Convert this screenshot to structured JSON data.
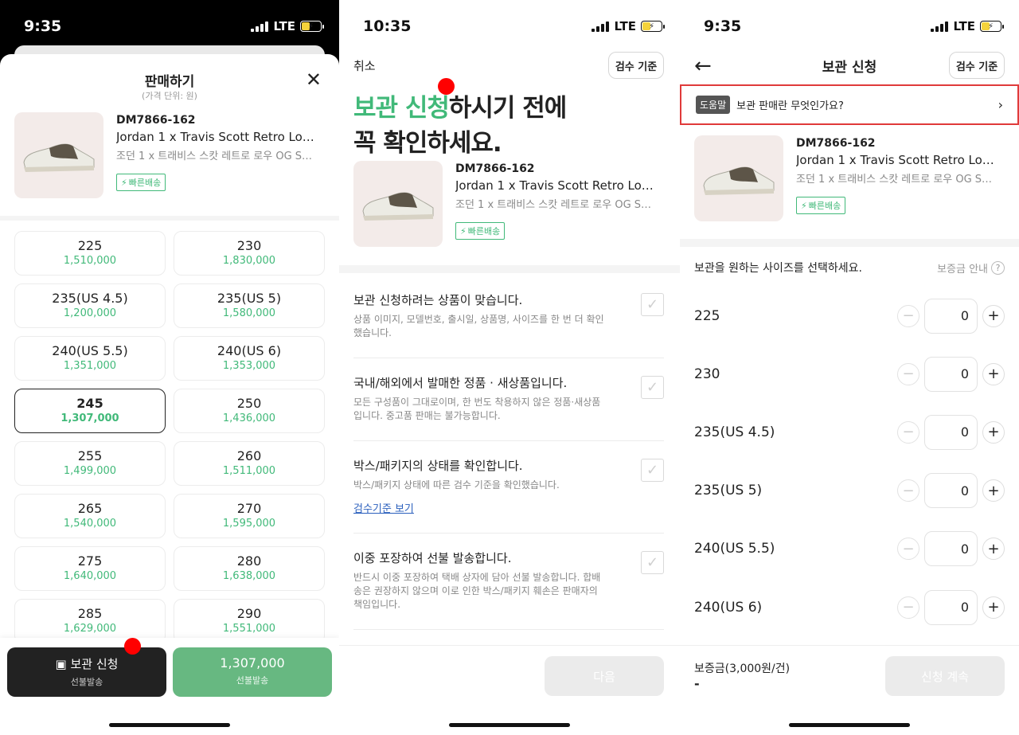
{
  "status_bars": [
    {
      "time": "9:35",
      "network": "LTE"
    },
    {
      "time": "10:35",
      "network": "LTE"
    },
    {
      "time": "9:35",
      "network": "LTE"
    }
  ],
  "product": {
    "code": "DM7866-162",
    "name": "Jordan 1 x Travis Scott Retro Low…",
    "korean_name": "조던 1 x 트래비스 스캇 레트로 로우 OG S…",
    "badge": "빠른배송"
  },
  "sell_sheet": {
    "title": "판매하기",
    "subtitle": "(가격 단위: 원)",
    "selected_index": 6,
    "sizes": [
      {
        "size": "225",
        "price": "1,510,000"
      },
      {
        "size": "230",
        "price": "1,830,000"
      },
      {
        "size": "235(US 4.5)",
        "price": "1,200,000"
      },
      {
        "size": "235(US 5)",
        "price": "1,580,000"
      },
      {
        "size": "240(US 5.5)",
        "price": "1,351,000"
      },
      {
        "size": "240(US 6)",
        "price": "1,353,000"
      },
      {
        "size": "245",
        "price": "1,307,000"
      },
      {
        "size": "250",
        "price": "1,436,000"
      },
      {
        "size": "255",
        "price": "1,499,000"
      },
      {
        "size": "260",
        "price": "1,511,000"
      },
      {
        "size": "265",
        "price": "1,540,000"
      },
      {
        "size": "270",
        "price": "1,595,000"
      },
      {
        "size": "275",
        "price": "1,640,000"
      },
      {
        "size": "280",
        "price": "1,638,000"
      },
      {
        "size": "285",
        "price": "1,629,000"
      },
      {
        "size": "290",
        "price": "1,551,000"
      }
    ],
    "storage_button": {
      "label": "보관 신청",
      "sub": "선불발송"
    },
    "price_button": {
      "label": "1,307,000",
      "sub": "선불발송"
    }
  },
  "confirm": {
    "cancel": "취소",
    "inspect_button": "검수 기준",
    "heading_green": "보관 신청",
    "heading_rest1": "하시기 전에",
    "heading_line2": "꼭 확인하세요.",
    "items": [
      {
        "title": "보관 신청하려는 상품이 맞습니다.",
        "desc": "상품 이미지, 모델번호, 출시일, 상품명, 사이즈를 한 번 더 확인했습니다."
      },
      {
        "title": "국내/해외에서 발매한 정품 · 새상품입니다.",
        "desc": "모든 구성품이 그대로이며, 한 번도 착용하지 않은 정품·새상품입니다. 중고품 판매는 불가능합니다."
      },
      {
        "title": "박스/패키지의 상태를 확인합니다.",
        "desc": "박스/패키지 상태에 따른 검수 기준을 확인했습니다.",
        "link": "검수기준 보기"
      },
      {
        "title": "이중 포장하여 선불 발송합니다.",
        "desc": "반드시 이중 포장하여 택배 상자에 담아 선불 발송합니다. 합배송은 권장하지 않으며 이로 인한 박스/패키지 훼손은 판매자의 책임입니다."
      }
    ],
    "next_button": "다음"
  },
  "storage": {
    "title": "보관 신청",
    "inspect_button": "검수 기준",
    "help_tag": "도움말",
    "help_text": "보관 판매란 무엇인가요?",
    "size_prompt": "보관을 원하는 사이즈를 선택하세요.",
    "deposit_info": "보증금 안내",
    "rows": [
      {
        "size": "225",
        "qty": "0"
      },
      {
        "size": "230",
        "qty": "0"
      },
      {
        "size": "235(US 4.5)",
        "qty": "0"
      },
      {
        "size": "235(US 5)",
        "qty": "0"
      },
      {
        "size": "240(US 5.5)",
        "qty": "0"
      },
      {
        "size": "240(US 6)",
        "qty": "0"
      }
    ],
    "deposit_label": "보증금(3,000원/건)",
    "deposit_value": "-",
    "continue_button": "신청 계속"
  },
  "colors": {
    "accent_green": "#41b979",
    "button_green": "#67b881",
    "highlight_red": "#e03a3a"
  }
}
